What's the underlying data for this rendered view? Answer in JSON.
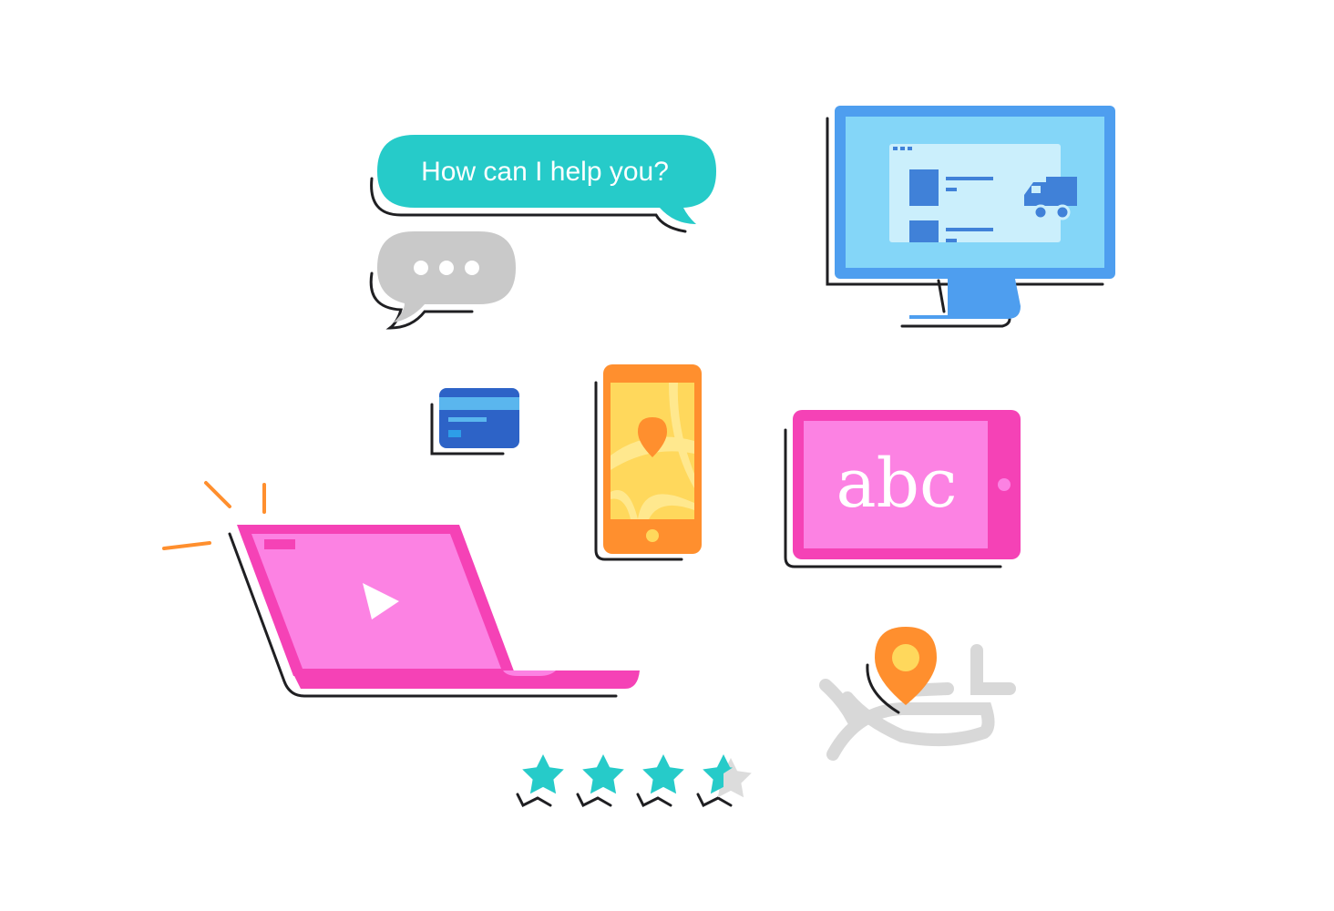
{
  "chat": {
    "question": "How can I help you?"
  },
  "tablet": {
    "text": "abc"
  },
  "rating": {
    "value": 3.5,
    "max": 4
  },
  "colors": {
    "teal": "#26CBC9",
    "gray_bubble": "#C9C9C9",
    "monitor_blue": "#4E9EEF",
    "monitor_screen": "#84D6F8",
    "card_blue": "#2D63C7",
    "phone_orange": "#FF8F2E",
    "map_yellow": "#FFD85C",
    "magenta": "#F542B6",
    "pink_screen": "#FC82E3",
    "outline": "#1F1F22"
  },
  "icons": [
    "chat-bubble-icon",
    "typing-bubble-icon",
    "desktop-monitor-icon",
    "delivery-truck-icon",
    "credit-card-icon",
    "smartphone-map-icon",
    "map-pin-icon",
    "tablet-icon",
    "laptop-video-icon",
    "play-icon",
    "star-icon",
    "location-pin-icon"
  ]
}
